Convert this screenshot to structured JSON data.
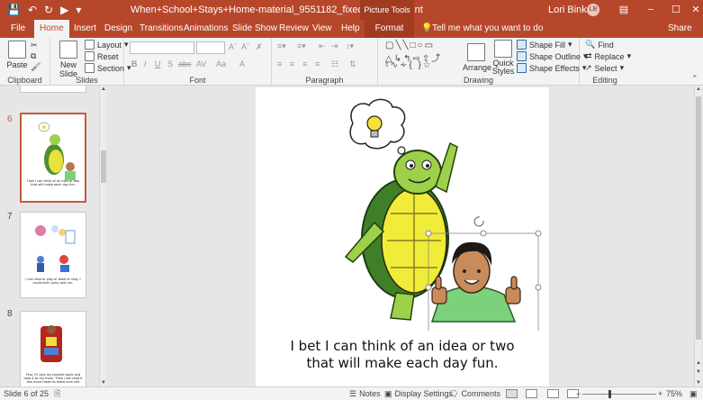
{
  "title_bar": {
    "doc_title": "When+School+Stays+Home-material_9551182_fixed  -  PowerPoint",
    "context_label": "Picture Tools",
    "user_name": "Lori Binko",
    "user_initials": "LB",
    "controls": [
      "−",
      "☐",
      "✕"
    ]
  },
  "tabs": {
    "items": [
      "File",
      "Home",
      "Insert",
      "Design",
      "Transitions",
      "Animations",
      "Slide Show",
      "Review",
      "View",
      "Help",
      "Format"
    ],
    "active": "Home",
    "tell_me": "Tell me what you want to do",
    "share": "Share"
  },
  "ribbon": {
    "clipboard": {
      "label": "Clipboard",
      "paste": "Paste"
    },
    "slides": {
      "label": "Slides",
      "new_slide": "New Slide",
      "layout": "Layout",
      "reset": "Reset",
      "section": "Section"
    },
    "font": {
      "label": "Font",
      "bold": "B",
      "italic": "I",
      "underline": "U",
      "strike": "S",
      "shadow": "abc",
      "spacing": "AV",
      "case": "Aa",
      "color": "A"
    },
    "paragraph": {
      "label": "Paragraph"
    },
    "drawing": {
      "label": "Drawing",
      "arrange": "Arrange",
      "quick_styles": "Quick Styles",
      "shape_fill": "Shape Fill",
      "shape_outline": "Shape Outline",
      "shape_effects": "Shape Effects"
    },
    "editing": {
      "label": "Editing",
      "find": "Find",
      "replace": "Replace",
      "select": "Select"
    }
  },
  "slides_panel": {
    "thumbnails": [
      {
        "number": "6",
        "caption": "I bet I can think of an idea or two that will make each day fun.",
        "selected": true
      },
      {
        "number": "7",
        "caption": "I can read or play or bake or sing. I could even jump and run.",
        "selected": false
      },
      {
        "number": "8",
        "caption": "First, I'll pick my favorite book and read it to my mom. Then I will read it two more times to make sure she",
        "selected": false
      }
    ]
  },
  "slide": {
    "text_line1": "I bet I can think of an idea or two",
    "text_line2": "that will make each day fun."
  },
  "status": {
    "slide_counter": "Slide 6 of 25",
    "notes": "Notes",
    "display_settings": "Display Settings",
    "comments": "Comments",
    "zoom": "75%",
    "zoom_level": 0.75
  },
  "colors": {
    "accent": "#b7472a",
    "selected_thumb": "#c55a3c"
  }
}
